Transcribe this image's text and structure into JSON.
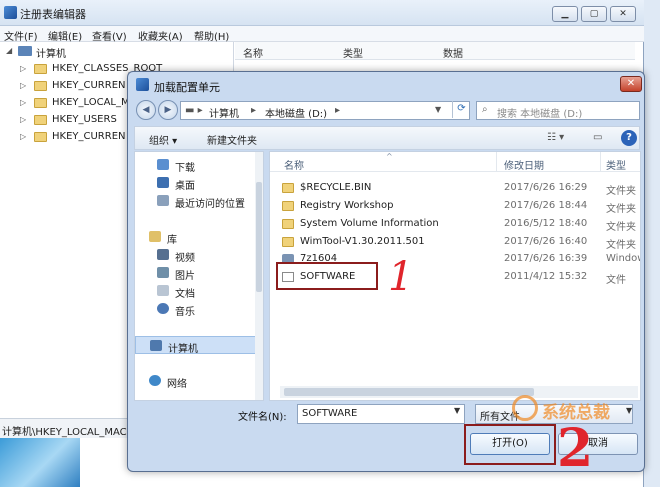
{
  "regedit": {
    "title": "注册表编辑器",
    "menu": [
      "文件(F)",
      "编辑(E)",
      "查看(V)",
      "收藏夹(A)",
      "帮助(H)"
    ],
    "tree_root": "计算机",
    "tree_items": [
      "HKEY_CLASSES_ROOT",
      "HKEY_CURREN",
      "HKEY_LOCAL_M",
      "HKEY_USERS",
      "HKEY_CURREN"
    ],
    "columns": [
      "名称",
      "类型",
      "数据"
    ],
    "status_path": "计算机\\HKEY_LOCAL_MAC"
  },
  "dialog": {
    "title": "加载配置单元",
    "address": [
      "计算机",
      "本地磁盘 (D:)"
    ],
    "search_placeholder": "搜索 本地磁盘 (D:)",
    "toolbar": {
      "organize": "组织",
      "new_folder": "新建文件夹"
    },
    "nav_items": [
      "下载",
      "桌面",
      "最近访问的位置",
      "库",
      "视频",
      "图片",
      "文档",
      "音乐",
      "计算机",
      "网络"
    ],
    "columns": {
      "name": "名称",
      "modified": "修改日期",
      "type": "类型"
    },
    "files": [
      {
        "name": "$RECYCLE.BIN",
        "date": "2017/6/26 16:29",
        "type": "文件夹"
      },
      {
        "name": "Registry Workshop",
        "date": "2017/6/26 18:44",
        "type": "文件夹"
      },
      {
        "name": "System Volume Information",
        "date": "2016/5/12 18:40",
        "type": "文件夹"
      },
      {
        "name": "WimTool-V1.30.2011.501",
        "date": "2017/6/26 16:40",
        "type": "文件夹"
      },
      {
        "name": "7z1604",
        "date": "2017/6/26 16:39",
        "type": "Windows"
      },
      {
        "name": "SOFTWARE",
        "date": "2011/4/12 15:32",
        "type": "文件"
      }
    ],
    "filename_label": "文件名(N):",
    "filename_value": "SOFTWARE",
    "filetype_value": "所有文件",
    "open_button": "打开(O)",
    "cancel_button": "取消"
  },
  "annotations": {
    "step1": "1",
    "step2": "2",
    "watermark": "系统总裁"
  },
  "colors": {
    "highlight_box": "#8b1c1c",
    "annotation": "#e0252c",
    "selection": "#cde0f7"
  }
}
